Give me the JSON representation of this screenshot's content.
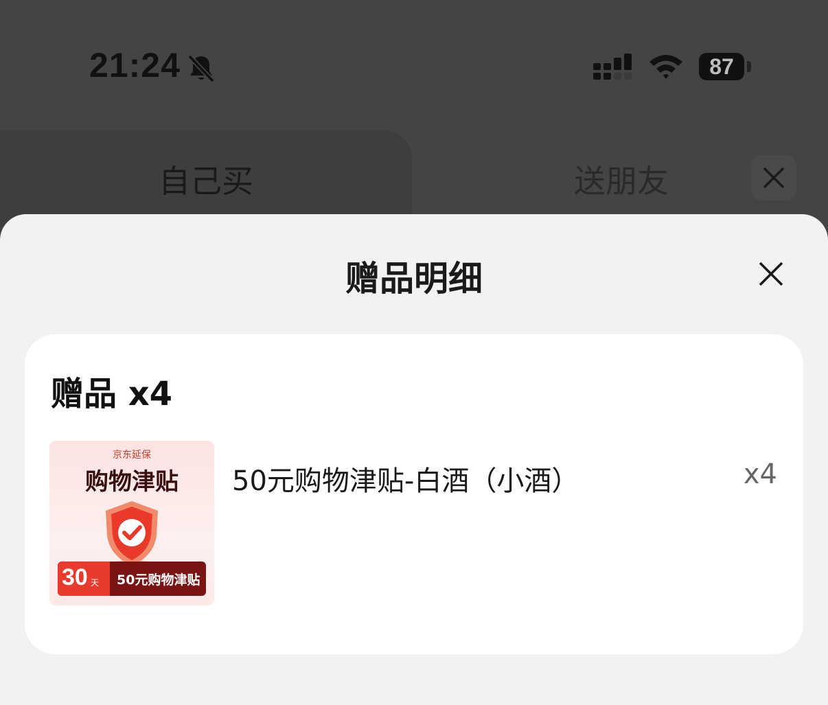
{
  "status_bar": {
    "time": "21:24",
    "battery_level": "87",
    "icons": [
      "bell-muted-icon",
      "cellular-signal-icon",
      "wifi-icon",
      "battery-icon"
    ]
  },
  "tabs": [
    {
      "label": "自己买",
      "selected": true
    },
    {
      "label": "送朋友",
      "selected": false
    }
  ],
  "sheet": {
    "title": "赠品明细",
    "card_title": "赠品 x4",
    "items": [
      {
        "name": "50元购物津贴-白酒（小酒）",
        "quantity": "x4",
        "thumbnail": {
          "brand": "京东延保",
          "title": "购物津贴",
          "days": "30",
          "days_unit": "天",
          "banner_text": "50元购物津贴"
        }
      }
    ]
  },
  "colors": {
    "overlay": "#444444",
    "sheet_bg": "#f2f2f2",
    "card_bg": "#ffffff",
    "brand_red": "#e83b2e"
  }
}
